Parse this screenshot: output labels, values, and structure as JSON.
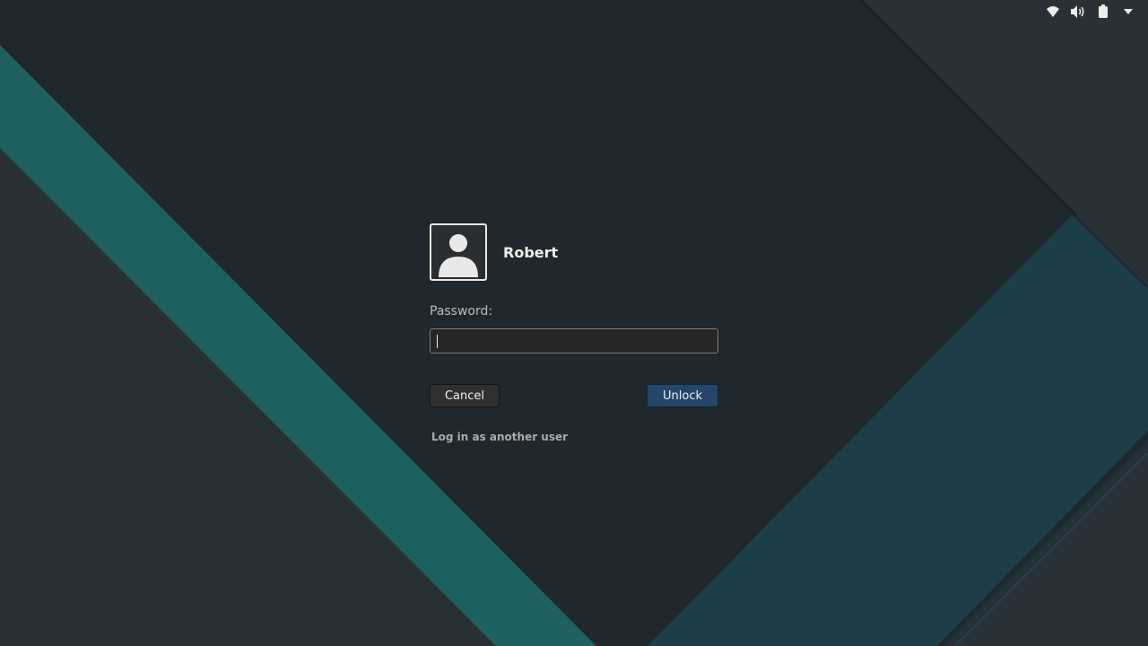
{
  "screen": {
    "background_color": "#2a3136",
    "accent_teal": "#1e6060",
    "accent_blue": "#1b3f4b"
  },
  "top_panel": {
    "icons": [
      "wifi-icon",
      "volume-icon",
      "battery-icon",
      "menu-arrow-icon"
    ]
  },
  "lock_screen": {
    "user_name": "Robert",
    "password_label": "Password:",
    "password_value": "",
    "cancel_label": "Cancel",
    "unlock_label": "Unlock",
    "switch_user_label": "Log in as another user"
  }
}
